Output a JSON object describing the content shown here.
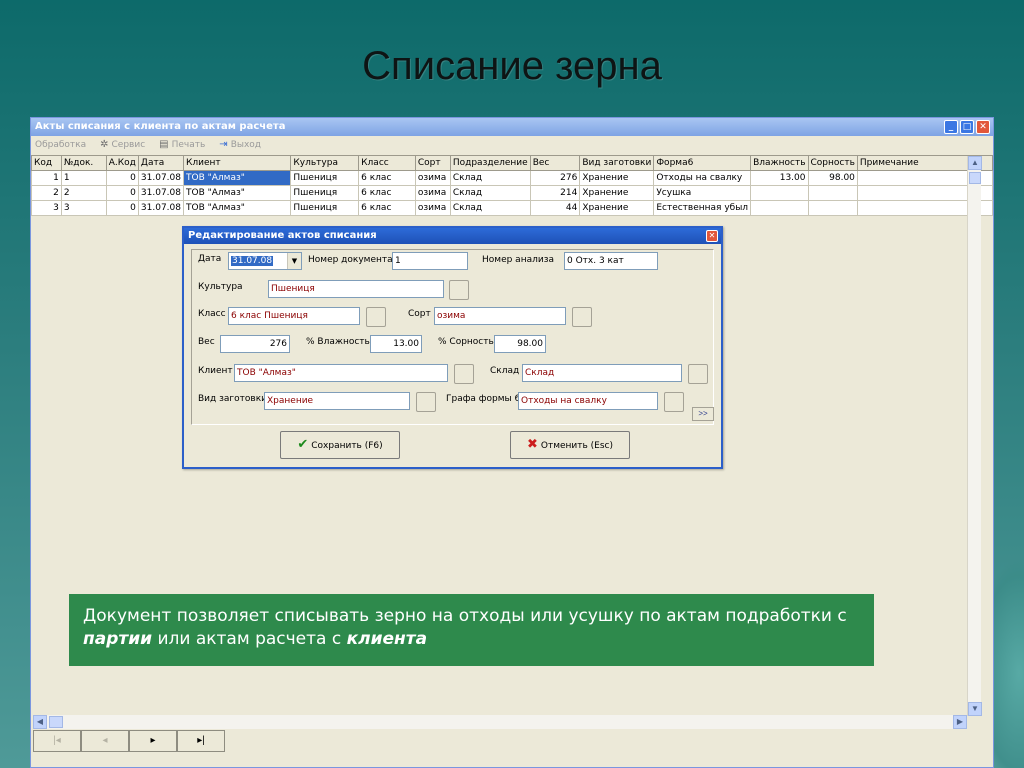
{
  "slide": {
    "title": "Списание зерна",
    "caption_part1": "Документ позволяет списывать зерно на отходы или усушку по актам подработки  с ",
    "caption_bold1": "партии",
    "caption_part2": " или актам расчета с ",
    "caption_bold2": "клиента"
  },
  "window": {
    "title": "Акты списания с клиента по актам расчета",
    "menu": [
      "Обработка",
      "Сервис",
      "Печать",
      "Выход"
    ]
  },
  "grid": {
    "columns": [
      "Код",
      "№док.",
      "А.Код",
      "Дата",
      "Клиент",
      "Культура",
      "Класс",
      "Сорт",
      "Подразделение",
      "Вес",
      "Вид заготовки",
      "Форма6",
      "Влажность",
      "Сорность",
      "Примечание"
    ],
    "rows": [
      {
        "kod": "1",
        "doc": "1",
        "akod": "0",
        "date": "31.07.08",
        "client": "ТОВ \"Алмаз\"",
        "culture": "Пшениця",
        "klass": "6 клас",
        "sort": "озима",
        "division": "Склад",
        "weight": "276",
        "kind": "Хранение",
        "form6": "Отходы на свалку",
        "humidity": "13.00",
        "trash": "98.00",
        "note": ""
      },
      {
        "kod": "2",
        "doc": "2",
        "akod": "0",
        "date": "31.07.08",
        "client": "ТОВ \"Алмаз\"",
        "culture": "Пшениця",
        "klass": "6 клас",
        "sort": "озима",
        "division": "Склад",
        "weight": "214",
        "kind": "Хранение",
        "form6": "Усушка",
        "humidity": "",
        "trash": "",
        "note": ""
      },
      {
        "kod": "3",
        "doc": "3",
        "akod": "0",
        "date": "31.07.08",
        "client": "ТОВ \"Алмаз\"",
        "culture": "Пшениця",
        "klass": "6 клас",
        "sort": "озима",
        "division": "Склад",
        "weight": "44",
        "kind": "Хранение",
        "form6": "Естественная убыл",
        "humidity": "",
        "trash": "",
        "note": ""
      }
    ]
  },
  "nav": {
    "first": "|◂",
    "prev": "◂",
    "next": "▸",
    "last": "▸|"
  },
  "dialog": {
    "title": "Редактирование актов списания",
    "date_label": "Дата",
    "date_value": "31.07.08",
    "docnum_label": "Номер документа",
    "docnum_value": "1",
    "analysis_label": "Номер анализа",
    "analysis_value": "0 Отх. 3 кат",
    "culture_label": "Культура",
    "culture_value": "Пшениця",
    "class_label": "Класс",
    "class_value": "6 клас Пшениця",
    "sort_label": "Сорт",
    "sort_value": "озима",
    "weight_label": "Вес",
    "weight_value": "276",
    "humidity_label": "% Влажность",
    "humidity_value": "13.00",
    "trash_label": "% Сорность",
    "trash_value": "98.00",
    "client_label": "Клиент",
    "client_value": "ТОВ \"Алмаз\"",
    "store_label": "Склад",
    "store_value": "Склад",
    "kind_label": "Вид заготовки",
    "kind_value": "Хранение",
    "form6_label": "Графа формы 6",
    "form6_value": "Отходы на свалку",
    "more": ">>",
    "save": "Сохранить (F6)",
    "cancel": "Отменить (Esc)"
  },
  "colors": {
    "selection": "#316ac5",
    "caption_bg": "#2e8a4c",
    "dialog_title": "#1e51b7"
  }
}
